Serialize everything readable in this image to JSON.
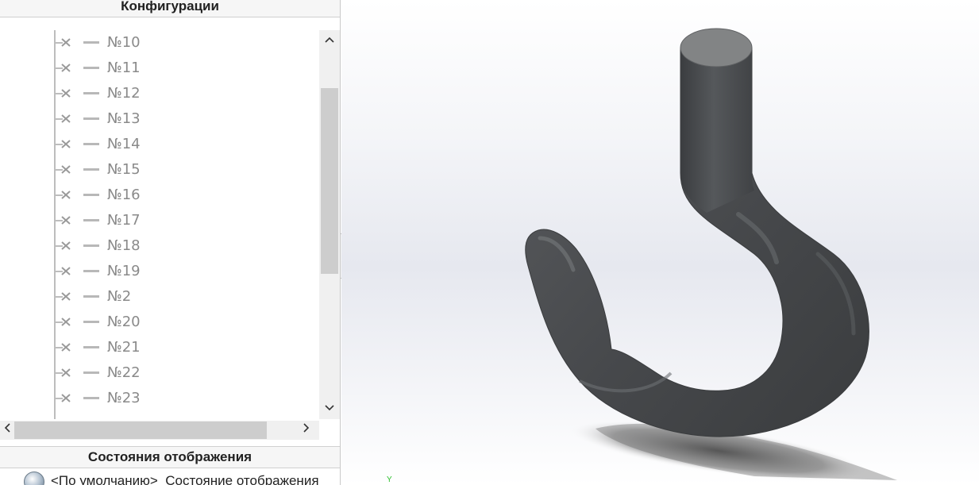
{
  "config_panel": {
    "title": "Конфигурации",
    "items": [
      {
        "label": "№10"
      },
      {
        "label": "№11"
      },
      {
        "label": "№12"
      },
      {
        "label": "№13"
      },
      {
        "label": "№14"
      },
      {
        "label": "№15"
      },
      {
        "label": "№16"
      },
      {
        "label": "№17"
      },
      {
        "label": "№18"
      },
      {
        "label": "№19"
      },
      {
        "label": "№2"
      },
      {
        "label": "№20"
      },
      {
        "label": "№21"
      },
      {
        "label": "№22"
      },
      {
        "label": "№23"
      }
    ]
  },
  "display_states": {
    "title": "Состояния отображения",
    "item_label": "<По умолчанию>_Состояние отображения"
  },
  "viewport": {
    "axis_label": "Y",
    "model_color": "#4a4c4f"
  },
  "icons": {
    "scroll_up": "chevron-up-icon",
    "scroll_down": "chevron-down-icon",
    "scroll_left": "chevron-left-icon",
    "scroll_right": "chevron-right-icon",
    "config_item": "suppressed-config-icon",
    "display_state": "display-state-icon"
  }
}
